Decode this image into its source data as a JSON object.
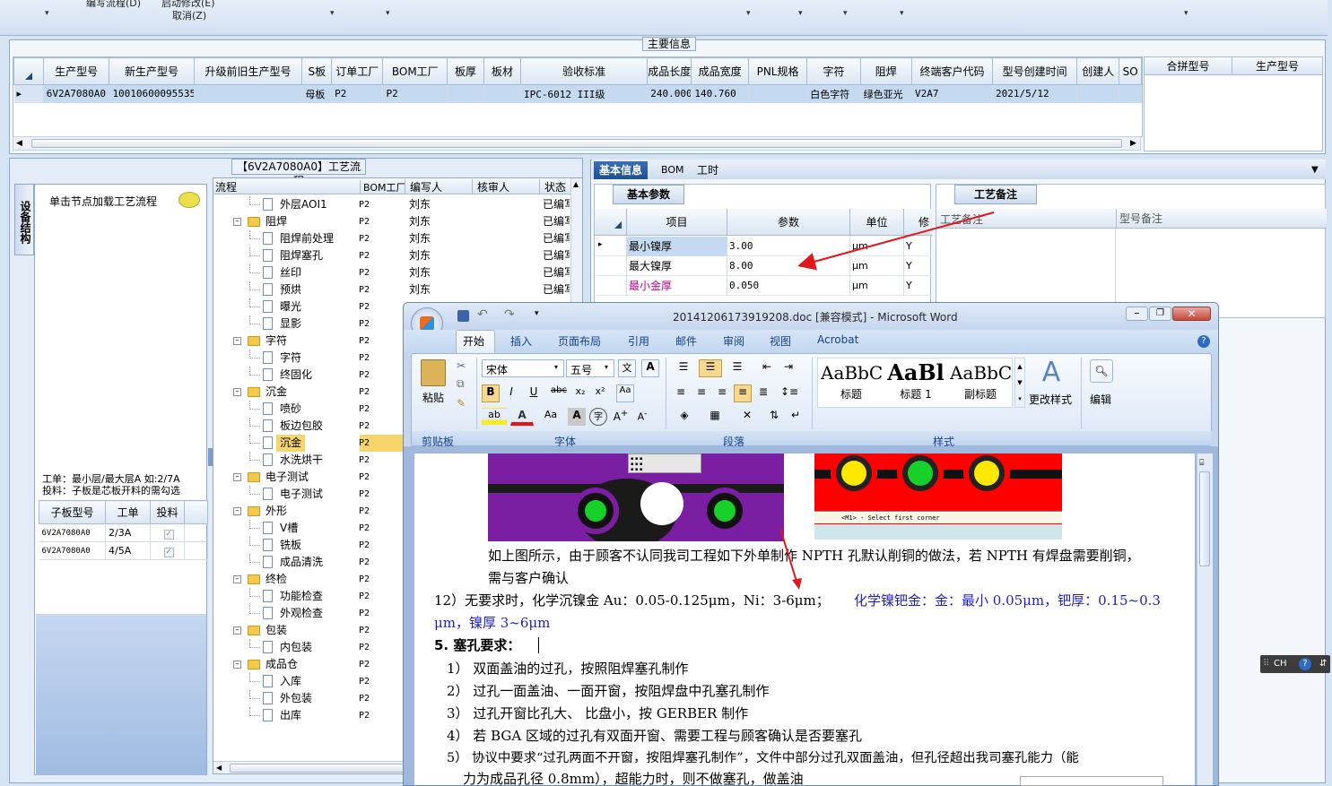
{
  "topbar": {
    "text1": "编写流程(D)",
    "text2": "启动修改(E)",
    "cancel": "取消(Z)"
  },
  "main": {
    "title": "主要信息",
    "columns": [
      "生产型号",
      "新生产型号",
      "升级前旧生产型号",
      "S板",
      "订单工厂",
      "BOM工厂",
      "板厚",
      "板材",
      "验收标准",
      "成品长度",
      "成品宽度",
      "PNL规格",
      "字符",
      "阻焊",
      "终端客户代码",
      "型号创建时间",
      "创建人",
      "SO"
    ],
    "row": [
      "6V2A7080A0",
      "10010600095535",
      "",
      "母板",
      "P2",
      "P2",
      "",
      "",
      "IPC-6012 III级",
      "240.000",
      "140.760",
      "",
      "白色字符",
      "绿色亚光",
      "V2A7",
      "2021/5/12",
      "",
      ""
    ],
    "merge_columns": [
      "合拼型号",
      "生产型号"
    ]
  },
  "flow": {
    "title": "【6V2A7080A0】工艺流程",
    "columns": [
      "流程",
      "BOM工厂",
      "编写人",
      "核审人",
      "状态"
    ],
    "rows": [
      {
        "name": "外层AOI1",
        "type": "doc",
        "level": 2,
        "bom": "P2",
        "writer": "刘东",
        "status": "已编写"
      },
      {
        "name": "阻焊",
        "type": "folder",
        "level": 1,
        "bom": "P2",
        "writer": "刘东",
        "status": "已编写"
      },
      {
        "name": "阻焊前处理",
        "type": "doc",
        "level": 2,
        "bom": "P2",
        "writer": "刘东",
        "status": "已编写"
      },
      {
        "name": "阻焊塞孔",
        "type": "doc",
        "level": 2,
        "bom": "P2",
        "writer": "刘东",
        "status": "已编写"
      },
      {
        "name": "丝印",
        "type": "doc",
        "level": 2,
        "bom": "P2",
        "writer": "刘东",
        "status": "已编写"
      },
      {
        "name": "预烘",
        "type": "doc",
        "level": 2,
        "bom": "P2",
        "writer": "刘东",
        "status": "已编写"
      },
      {
        "name": "曝光",
        "type": "doc",
        "level": 2,
        "bom": "P2",
        "writer": "",
        "status": ""
      },
      {
        "name": "显影",
        "type": "doc",
        "level": 2,
        "bom": "P2",
        "writer": "",
        "status": ""
      },
      {
        "name": "字符",
        "type": "folder",
        "level": 1,
        "bom": "P2",
        "writer": "",
        "status": ""
      },
      {
        "name": "字符",
        "type": "doc",
        "level": 2,
        "bom": "P2",
        "writer": "",
        "status": ""
      },
      {
        "name": "终固化",
        "type": "doc",
        "level": 2,
        "bom": "P2",
        "writer": "",
        "status": ""
      },
      {
        "name": "沉金",
        "type": "folder",
        "level": 1,
        "bom": "P2",
        "writer": "",
        "status": ""
      },
      {
        "name": "喷砂",
        "type": "doc",
        "level": 2,
        "bom": "P2",
        "writer": "",
        "status": ""
      },
      {
        "name": "板边包胶",
        "type": "doc",
        "level": 2,
        "bom": "P2",
        "writer": "",
        "status": ""
      },
      {
        "name": "沉金",
        "type": "doc",
        "level": 2,
        "bom": "P2",
        "writer": "",
        "status": "",
        "selected": true
      },
      {
        "name": "水洗烘干",
        "type": "doc",
        "level": 2,
        "bom": "P2",
        "writer": "",
        "status": ""
      },
      {
        "name": "电子测试",
        "type": "folder",
        "level": 1,
        "bom": "P2",
        "writer": "",
        "status": ""
      },
      {
        "name": "电子测试",
        "type": "doc",
        "level": 2,
        "bom": "P2",
        "writer": "",
        "status": ""
      },
      {
        "name": "外形",
        "type": "folder",
        "level": 1,
        "bom": "P2",
        "writer": "",
        "status": ""
      },
      {
        "name": "V槽",
        "type": "doc",
        "level": 2,
        "bom": "P2",
        "writer": "",
        "status": ""
      },
      {
        "name": "铣板",
        "type": "doc",
        "level": 2,
        "bom": "P2",
        "writer": "",
        "status": ""
      },
      {
        "name": "成品清洗",
        "type": "doc",
        "level": 2,
        "bom": "P2",
        "writer": "",
        "status": ""
      },
      {
        "name": "终检",
        "type": "folder",
        "level": 1,
        "bom": "P2",
        "writer": "",
        "status": ""
      },
      {
        "name": "功能检查",
        "type": "doc",
        "level": 2,
        "bom": "P2",
        "writer": "",
        "status": ""
      },
      {
        "name": "外观检查",
        "type": "doc",
        "level": 2,
        "bom": "P2",
        "writer": "",
        "status": ""
      },
      {
        "name": "包装",
        "type": "folder",
        "level": 1,
        "bom": "P2",
        "writer": "",
        "status": ""
      },
      {
        "name": "内包装",
        "type": "doc",
        "level": 2,
        "bom": "P2",
        "writer": "",
        "status": ""
      },
      {
        "name": "成品仓",
        "type": "folder",
        "level": 1,
        "bom": "P2",
        "writer": "",
        "status": ""
      },
      {
        "name": "入库",
        "type": "doc",
        "level": 2,
        "bom": "P2",
        "writer": "",
        "status": ""
      },
      {
        "name": "外包装",
        "type": "doc",
        "level": 2,
        "bom": "P2",
        "writer": "",
        "status": ""
      },
      {
        "name": "出库",
        "type": "doc",
        "level": 2,
        "bom": "P2",
        "writer": "",
        "status": ""
      }
    ]
  },
  "side": {
    "vtab": "设备结构",
    "hint": "单击节点加载工艺流程",
    "note1": "工单：最小层/最大层A 如:2/7A",
    "note2": "投料：子板是芯板开料的需勾选",
    "columns": [
      "子板型号",
      "工单",
      "投料"
    ],
    "rows": [
      [
        "6V2A7080A0",
        "2/3A"
      ],
      [
        "6V2A7080A0",
        "4/5A"
      ]
    ]
  },
  "right": {
    "tabs": [
      "基本信息",
      "BOM",
      "工时"
    ],
    "params_tab": "基本参数",
    "notes_tab": "工艺备注",
    "param_columns": [
      "项目",
      "参数",
      "单位",
      "修"
    ],
    "params": [
      {
        "item": "最小镍厚",
        "value": "3.00",
        "unit": "μm",
        "flag": "Y"
      },
      {
        "item": "最大镍厚",
        "value": "8.00",
        "unit": "μm",
        "flag": "Y"
      },
      {
        "item": "最小金厚",
        "value": "0.050",
        "unit": "μm",
        "flag": "Y"
      }
    ],
    "notes_columns": [
      "工艺备注",
      "型号备注"
    ]
  },
  "word": {
    "title": "20141206173919208.doc [兼容模式] - Microsoft Word",
    "tabs": [
      "开始",
      "插入",
      "页面布局",
      "引用",
      "邮件",
      "审阅",
      "视图",
      "Acrobat"
    ],
    "font_name": "宋体",
    "font_size": "五号",
    "paste_label": "粘贴",
    "styles": [
      {
        "sample": "AaBbC",
        "name": "标题"
      },
      {
        "sample": "AaBl",
        "name": "标题 1"
      },
      {
        "sample": "AaBbC",
        "name": "副标题"
      }
    ],
    "change_styles": "更改样式",
    "edit_label": "编辑",
    "groups": [
      "剪贴板",
      "字体",
      "段落",
      "样式"
    ],
    "caption": "<M1> - Select first corner",
    "doc_lines": [
      "如上图所示，由于顾客不认同我司工程如下外单制作 NPTH 孔默认削铜的做法，若 NPTH 有焊盘需要削铜，",
      "需与客户确认",
      "12）无要求时，化学沉镍金 Au：0.05-0.125μm，Ni：3-6μm；",
      "化学镍钯金：金：最小 0.05μm，钯厚：0.15~0.3",
      "μm，镍厚 3~6μm",
      "5.   塞孔要求：",
      "1）  双面盖油的过孔，按照阻焊塞孔制作",
      "2）  过孔一面盖油、一面开窗，按阻焊盘中孔塞孔制作",
      "3）  过孔开窗比孔大、 比盘小，按 GERBER 制作",
      "4）  若 BGA 区域的过孔有双面开窗、需要工程与顾客确认是否要塞孔",
      "5）  协议中要求“过孔两面不开窗，按阻焊塞孔制作”，文件中部分过孔双面盖油，但孔径超出我司塞孔能力（能",
      "力为成品孔径 0.8mm），超能力时，则不做塞孔，做盖油"
    ]
  },
  "ime": {
    "label": "CH"
  },
  "colors": {
    "accent": "#15428b",
    "selected": "#c5d9f1",
    "arrow": "#e0181b",
    "blue_text": "#1f1fbf",
    "pink": "#c0008c"
  }
}
